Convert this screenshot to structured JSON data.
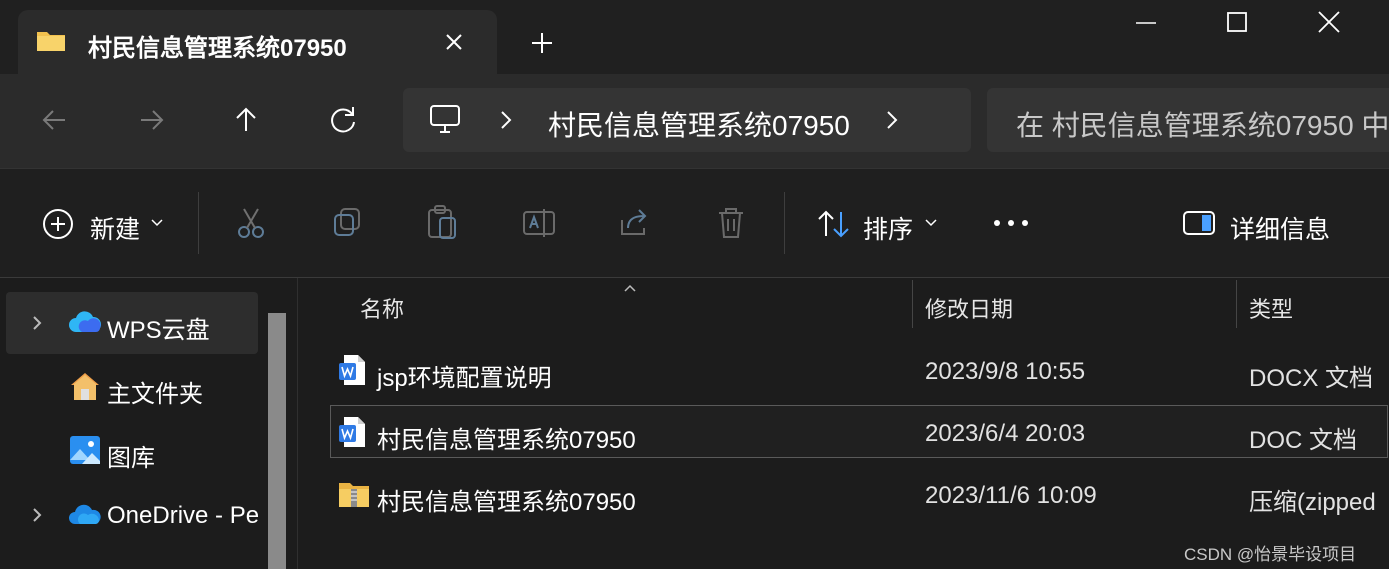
{
  "window": {
    "tab_title": "村民信息管理系统07950",
    "icons": {
      "folder": "folder-icon",
      "close_tab": "close-icon",
      "new_tab": "plus-icon",
      "minimize": "minimize-icon",
      "maximize": "maximize-icon",
      "close": "close-icon"
    }
  },
  "nav": {
    "breadcrumb_current": "村民信息管理系统07950",
    "search_placeholder": "在 村民信息管理系统07950 中",
    "icons": [
      "back-arrow-icon",
      "forward-arrow-icon",
      "up-arrow-icon",
      "refresh-icon",
      "computer-icon",
      "chevron-right-icon"
    ]
  },
  "toolbar": {
    "new_label": "新建",
    "sort_label": "排序",
    "details_label": "详细信息",
    "icons": [
      "plus-circle-icon",
      "cut-icon",
      "copy-icon",
      "paste-icon",
      "rename-icon",
      "share-icon",
      "delete-icon",
      "sort-icon",
      "more-icon",
      "details-pane-icon"
    ]
  },
  "sidebar": {
    "items": [
      {
        "label": "WPS云盘",
        "icon": "cloud-icon",
        "expandable": true,
        "selected": true
      },
      {
        "label": "主文件夹",
        "icon": "home-icon",
        "expandable": false,
        "selected": false
      },
      {
        "label": "图库",
        "icon": "gallery-icon",
        "expandable": false,
        "selected": false
      },
      {
        "label": "OneDrive - Pe",
        "icon": "onedrive-icon",
        "expandable": true,
        "selected": false
      }
    ]
  },
  "files": {
    "columns": [
      "名称",
      "修改日期",
      "类型"
    ],
    "rows": [
      {
        "name": "jsp环境配置说明",
        "modified": "2023/9/8 10:55",
        "type": "DOCX 文档",
        "icon": "word-doc-icon"
      },
      {
        "name": "村民信息管理系统07950",
        "modified": "2023/6/4 20:03",
        "type": "DOC 文档",
        "icon": "word-doc-icon",
        "selected": true
      },
      {
        "name": "村民信息管理系统07950",
        "modified": "2023/11/6 10:09",
        "type": "压缩(zipped",
        "icon": "zip-folder-icon"
      }
    ]
  },
  "watermark": "CSDN @怡景毕设项目",
  "colors": {
    "accent_blue": "#2f7ae5",
    "folder_yellow": "#f2c14e",
    "background": "#1c1c1c"
  }
}
